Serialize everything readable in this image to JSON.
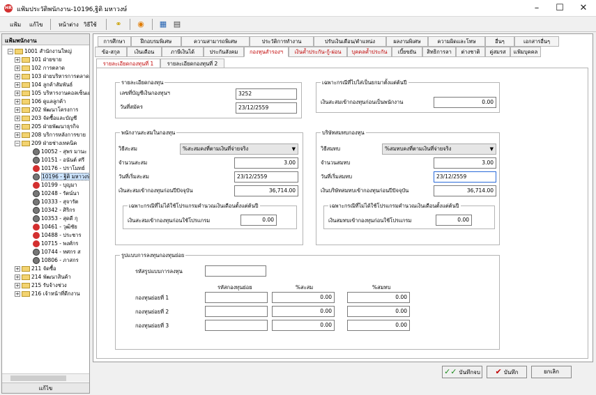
{
  "window": {
    "title": "แฟ้มประวัติพนักงาน-10196,ฐิติ มหาวงษ์",
    "app_badge": "HR"
  },
  "menu": {
    "items": [
      "แฟ้ม",
      "แก้ไข",
      "หน้าต่าง",
      "วิธีใช้"
    ]
  },
  "left_panel": {
    "header": "แฟ้มพนักงาน",
    "footer": "แก้ไข",
    "tree": [
      {
        "label": "1001 สำนักงานใหญ่",
        "kind": "folder",
        "expander": "−"
      },
      {
        "label": "101 ฝ่ายขาย",
        "kind": "folder",
        "expander": "+"
      },
      {
        "label": "102 การตลาด",
        "kind": "folder",
        "expander": "+"
      },
      {
        "label": "103 ฝ่ายบริหารการตลาด",
        "kind": "folder",
        "expander": "+"
      },
      {
        "label": "104 ลูกค้าสัมพันธ์",
        "kind": "folder",
        "expander": "+"
      },
      {
        "label": "105 บริหารงานคอลเซ็นเตอร์",
        "kind": "folder",
        "expander": "+"
      },
      {
        "label": "106 ดูแลลูกค้า",
        "kind": "folder",
        "expander": "+"
      },
      {
        "label": "202 พัฒนาโครงการ",
        "kind": "folder",
        "expander": "+"
      },
      {
        "label": "203 จัดซื้อและบัญชี",
        "kind": "folder",
        "expander": "+"
      },
      {
        "label": "205 ฝ่ายพัฒนาธุรกิจ",
        "kind": "folder",
        "expander": "+"
      },
      {
        "label": "208 บริการหลังการขาย",
        "kind": "folder",
        "expander": "+"
      },
      {
        "label": "209 ฝ่ายช่างเทคนิค",
        "kind": "folder",
        "expander": "−"
      },
      {
        "label": "10052 - สุพร มานะ",
        "kind": "person"
      },
      {
        "label": "10151 - อนันต์ ศรี",
        "kind": "person"
      },
      {
        "label": "10176 - ปราโมทย์",
        "kind": "stop"
      },
      {
        "label": "10196 - ฐิติ มหาวงษ์",
        "kind": "person",
        "selected": true
      },
      {
        "label": "10199 - บุญมา",
        "kind": "stop"
      },
      {
        "label": "10248 - รัตน์นา",
        "kind": "person"
      },
      {
        "label": "10333 - สุจารัต",
        "kind": "person"
      },
      {
        "label": "10342 - ศิริกร",
        "kind": "person"
      },
      {
        "label": "10353 - สุดดี กุ",
        "kind": "person"
      },
      {
        "label": "10461 - วุฒิชัย",
        "kind": "stop"
      },
      {
        "label": "10488 - ประชาร",
        "kind": "stop"
      },
      {
        "label": "10715 - พงศ์กร",
        "kind": "stop"
      },
      {
        "label": "10744 - ทศกร ส",
        "kind": "person"
      },
      {
        "label": "10806 - ภาสกร",
        "kind": "person"
      },
      {
        "label": "211 จัดซื้อ",
        "kind": "folder",
        "expander": "+"
      },
      {
        "label": "214 พัฒนาสินค้า",
        "kind": "folder",
        "expander": "+"
      },
      {
        "label": "215 รับจ้างช่วง",
        "kind": "folder",
        "expander": "+"
      },
      {
        "label": "216 เจ้าหน้าที่ดีกงาน",
        "kind": "folder",
        "expander": "+"
      }
    ]
  },
  "tabs_row1": [
    "การศึกษา",
    "ฝึกอบรมพิเศษ",
    "ความสามารถพิเศษ",
    "ประวัติการทำงาน",
    "ปรับเงินเดือน/ตำแหน่ง",
    "ผลงานพิเศษ",
    "ความผิดและโทษ",
    "อื่นๆ",
    "เอกสารอื่นๆ"
  ],
  "tabs_row2": [
    "ข้อ-สกุล",
    "เงินเดือน",
    "ภาษีเงินได้",
    "ประกันสังคม",
    "กองทุนสำรองฯ",
    "เงินค้ำประกัน-กู้-ผ่อน",
    "บุคคลค้ำประกัน",
    "เบี้ยขยัน",
    "สิทธิการลา",
    "ต่างชาติ",
    "คู่สมรส",
    "แฟ้มบุคคล"
  ],
  "subtabs": [
    "รายละเอียดกองทุนที่ 1",
    "รายละเอียดกองทุนที่ 2"
  ],
  "fund_detail": {
    "title": "รายละเอียดกองทุน",
    "account_label": "เลขที่บัญชีเงินกองทุนฯ",
    "account_value": "3252",
    "apply_date_label": "วันที่สมัคร",
    "apply_date_value": "23/12/2559"
  },
  "first_year": {
    "title": "เฉพาะกรณีที่ไปใส่เป็นยกมาตั้งแต่ต้นปี",
    "label": "เงินสะสมเข้ากองทุนก่อนเป็นพนักงาน",
    "value": "0.00"
  },
  "employee_saving": {
    "title": "พนักงานสะสมในกองทุน",
    "method_label": "วิธีสะสม",
    "method_value": "%สะสมคงที่ตามเงินที่จ่ายจริง",
    "amount_label": "จำนวนสะสม",
    "amount_value": "3.00",
    "start_label": "วันที่เริ่มสะสม",
    "start_value": "23/12/2559",
    "before_label": "เงินสะสมเข้ากองทุนก่อนปีปัจจุบัน",
    "before_value": "36,714.00",
    "inner_title": "เฉพาะกรณีที่ไม่ได้ใช้โปรแกรมคำนวณเงินเดือนตั้งแต่ต้นปี",
    "inner_label": "เงินสะสมเข้ากองทุนก่อนใช้โปรแกรม",
    "inner_value": "0.00"
  },
  "company_contribution": {
    "title": "บริษัทสมทบกองทุน",
    "method_label": "วิธีสมทบ",
    "method_value": "%สมทบคงที่ตามเงินที่จ่ายจริง",
    "amount_label": "จำนวนสมทบ",
    "amount_value": "3.00",
    "start_label": "วันที่เริ่มสมทบ",
    "start_value": "23/12/2559",
    "before_label": "เงินบริษัทสมทบเข้ากองทุนก่อนปีปัจจุบัน",
    "before_value": "36,714.00",
    "inner_title": "เฉพาะกรณีที่ไม่ได้ใช้โปรแกรมคำนวณเงินเดือนตั้งแต่ต้นปี",
    "inner_label": "เงินสมทบเข้ากองทุนก่อนใช้โปรแกรม",
    "inner_value": "0.00"
  },
  "investment": {
    "title": "รูปแบบการลงทุนกองทุนย่อย",
    "code_label": "รหัสรูปแบบการลงทุน",
    "code_value": "",
    "headers": [
      "รหัสกองทุนย่อย",
      "%สะสม",
      "%สมทบ"
    ],
    "rows": [
      {
        "label": "กองทุนย่อยที่ 1",
        "code": "",
        "save": "0.00",
        "contrib": "0.00"
      },
      {
        "label": "กองทุนย่อยที่ 2",
        "code": "",
        "save": "0.00",
        "contrib": "0.00"
      },
      {
        "label": "กองทุนย่อยที่ 3",
        "code": "",
        "save": "0.00",
        "contrib": "0.00"
      }
    ]
  },
  "buttons": {
    "save_close": "บันทึกจบ",
    "save": "บันทึก",
    "cancel": "ยกเลิก"
  }
}
